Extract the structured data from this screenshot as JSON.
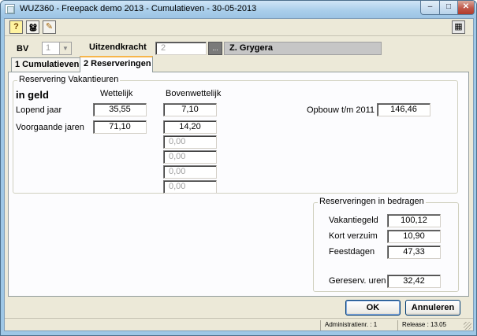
{
  "window": {
    "title": "WUZ360  -  Freepack demo 2013  -  Cumulatieven  -  30-05-2013",
    "minimize_glyph": "–",
    "maximize_glyph": "□",
    "close_glyph": "✕"
  },
  "toolbar": {
    "help_icon": "help-icon",
    "search_icon": "binoculars-icon",
    "edit_icon": "edit-icon",
    "calc_icon": "calculator-icon",
    "help_glyph": "?",
    "search_glyph": "ൠ",
    "edit_glyph": "✎",
    "calc_glyph": "▦"
  },
  "header": {
    "bv_label": "BV",
    "bv_value": "1",
    "uitzendkracht_label": "Uitzendkracht",
    "uitzendkracht_value": "2",
    "lookup_button": "...",
    "employee_name": "Z. Grygera"
  },
  "tabs": [
    {
      "label": "1 Cumulatieven",
      "active": false
    },
    {
      "label": "2 Reserveringen",
      "active": true
    }
  ],
  "reservering_vakantieuren": {
    "group_title": "Reservering Vakantieuren",
    "heading": "in geld",
    "col_wettelijk": "Wettelijk",
    "col_bovenwettelijk": "Bovenwettelijk",
    "rows": [
      {
        "label": "Lopend jaar",
        "wettelijk": "35,55",
        "bovenwettelijk": "7,10"
      },
      {
        "label": "Voorgaande jaren",
        "wettelijk": "71,10",
        "bovenwettelijk": "14,20"
      }
    ],
    "extra_bovenwettelijk": [
      "0,00",
      "0,00",
      "0,00",
      "0,00"
    ],
    "opbouw_label": "Opbouw t/m 2011",
    "opbouw_value": "146,46"
  },
  "reserveringen_bedragen": {
    "group_title": "Reserveringen in bedragen",
    "items": [
      {
        "label": "Vakantiegeld",
        "value": "100,12"
      },
      {
        "label": "Kort verzuim",
        "value": "10,90"
      },
      {
        "label": "Feestdagen",
        "value": "47,33"
      }
    ],
    "gereserv_label": "Gereserv. uren",
    "gereserv_value": "32,42"
  },
  "buttons": {
    "ok": "OK",
    "annuleren": "Annuleren"
  },
  "status": {
    "administratie": "Administratienr. :  1",
    "release": "Release : 13.05"
  }
}
